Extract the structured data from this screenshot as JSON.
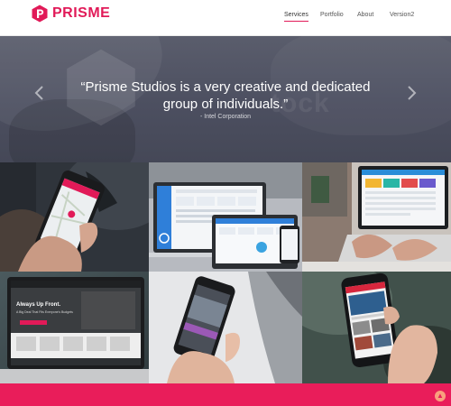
{
  "brand": {
    "name": "PRISME",
    "accent": "#e11a58"
  },
  "nav": {
    "items": [
      {
        "label": "Services"
      },
      {
        "label": "Portfolio"
      },
      {
        "label": "About"
      },
      {
        "label": "Version2"
      }
    ],
    "active": "Services"
  },
  "hero": {
    "quote": "“Prisme Studios is a very creative and dedicated group of individuals.”",
    "author": "- Intel Corporation",
    "watermark": "tock",
    "prev_icon": "chevron-left-icon",
    "next_icon": "chevron-right-icon"
  },
  "portfolio": {
    "tiles": [
      {
        "name": "portfolio-tile-phone-map"
      },
      {
        "name": "portfolio-tile-dashboard-devices"
      },
      {
        "name": "portfolio-tile-laptop-dashboard"
      },
      {
        "name": "portfolio-tile-laptop-website"
      },
      {
        "name": "portfolio-tile-phone-hand"
      },
      {
        "name": "portfolio-tile-phone-news"
      }
    ],
    "laptop_site_headline": "Always Up Front.",
    "laptop_site_subline": "A Big Deal That Fits Everyone's Budgets"
  },
  "footer": {
    "accent": "#e91d5a",
    "back_to_top_icon": "arrow-up-icon"
  }
}
